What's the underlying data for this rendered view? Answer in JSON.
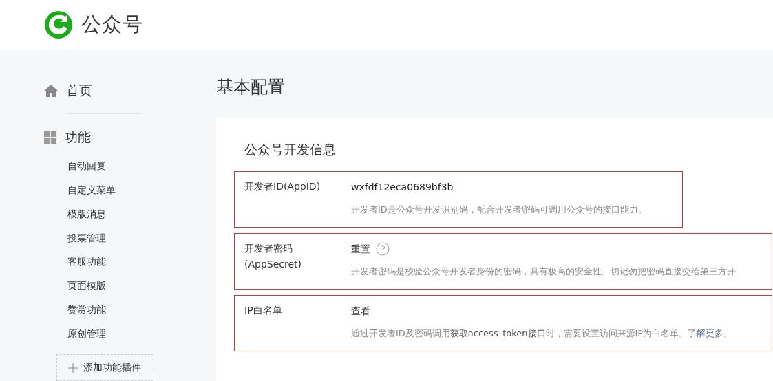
{
  "header": {
    "title": "公众号"
  },
  "sidebar": {
    "items": [
      {
        "label": "首页",
        "kind": "home"
      },
      {
        "label": "功能",
        "kind": "group",
        "children": [
          {
            "label": "自动回复"
          },
          {
            "label": "自定义菜单"
          },
          {
            "label": "模版消息"
          },
          {
            "label": "投票管理"
          },
          {
            "label": "客服功能"
          },
          {
            "label": "页面模版"
          },
          {
            "label": "赞赏功能"
          },
          {
            "label": "原创管理"
          }
        ]
      }
    ],
    "add_plugin": "添加功能插件"
  },
  "page_title": "基本配置",
  "section": {
    "title": "公众号开发信息",
    "rows": [
      {
        "label": "开发者ID(AppID)",
        "highlighted": true,
        "value": "wxfdf12eca0689bf3b",
        "value_link": false,
        "help": false,
        "description": [
          {
            "text": "开发者ID是公众号开发识别码，配合开发者密码可调用公众号的接口能力。",
            "kind": "plain"
          }
        ]
      },
      {
        "label": "开发者密码\n(AppSecret)",
        "highlighted": true,
        "value": "重置",
        "value_link": true,
        "help": true,
        "description": [
          {
            "text": "开发者密码是校验公众号开发者身份的密码，具有极高的安全性。切记勿把密码直接交给第三方开",
            "kind": "plain"
          }
        ]
      },
      {
        "label": "IP白名单",
        "highlighted": true,
        "value": "查看",
        "value_link": true,
        "help": false,
        "description": [
          {
            "text": "通过开发者ID及密码调用",
            "kind": "plain"
          },
          {
            "text": "获取access_token接口",
            "kind": "term"
          },
          {
            "text": "时，需要设置访问来源IP为白名单。",
            "kind": "plain"
          },
          {
            "text": "了解更多",
            "kind": "link"
          },
          {
            "text": "。",
            "kind": "plain"
          }
        ]
      }
    ]
  }
}
